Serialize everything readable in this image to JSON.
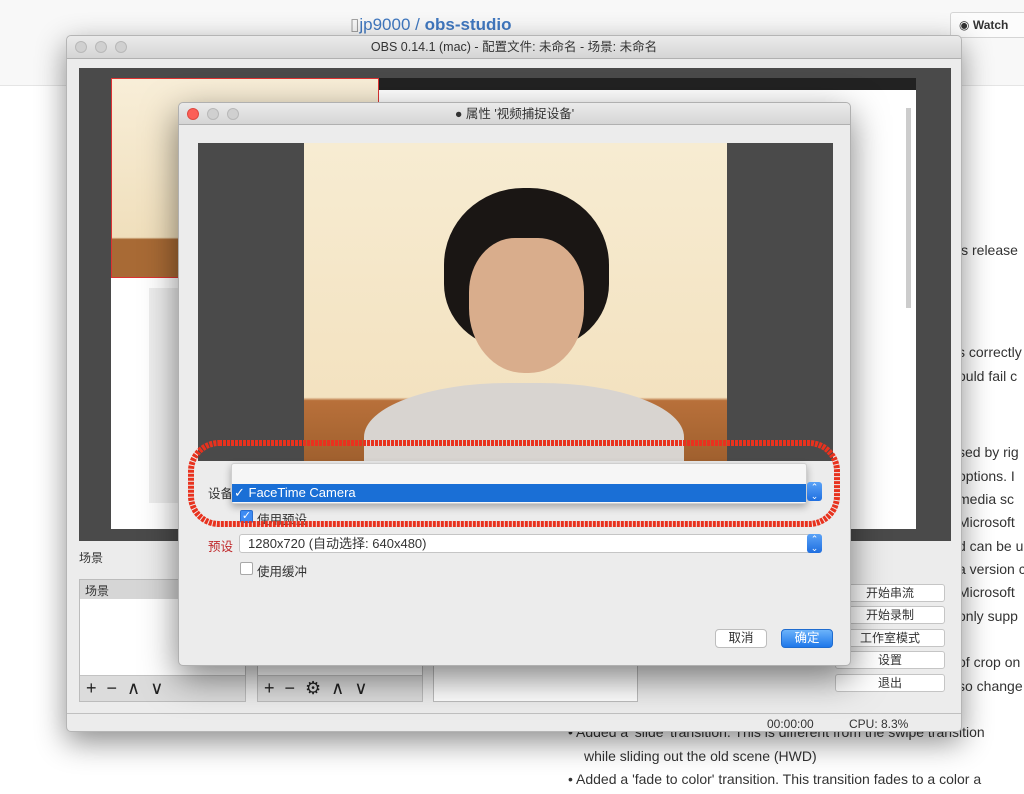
{
  "github": {
    "owner": "jp9000",
    "sep": "/",
    "repo": "obs-studio",
    "watch_label": "Watch",
    "right_fragments": [
      "is release",
      "s correctly",
      "ould fail c",
      "sed by rig",
      "options. I",
      "media sc",
      "Microsoft",
      "d can be u",
      "a version c",
      "Microsoft",
      "only supp",
      "of crop on",
      "so change"
    ],
    "bottom_lines": [
      "• Added a 'slide' transition. This is different from the swipe transition",
      "while sliding out the old scene (HWD)",
      "• Added a 'fade to color' transition. This transition fades to a color a"
    ]
  },
  "obs": {
    "title": "OBS 0.14.1 (mac) - 配置文件: 未命名 - 场景: 未命名",
    "scenes_label": "场景",
    "scenes_header": "场景",
    "buttons": [
      "开始串流",
      "开始录制",
      "工作室模式",
      "设置",
      "退出"
    ],
    "time": "00:00:00",
    "cpu": "CPU: 8.3%",
    "scene_controls": [
      "+",
      "−",
      "∧",
      "∨"
    ],
    "source_controls": [
      "+",
      "−",
      "∧",
      "∨"
    ]
  },
  "dialog": {
    "title": "属性 '视频捕捉设备'",
    "device_label": "设备",
    "device_selected": "✓ FaceTime Camera",
    "use_preset_label": "使用预设",
    "use_preset_checked": true,
    "preset_label": "预设",
    "preset_value": "1280x720 (自动选择: 640x480)",
    "use_buffer_label": "使用缓冲",
    "use_buffer_checked": false,
    "cancel": "取消",
    "ok": "确定"
  },
  "colors": {
    "annotation": "#e8321e",
    "accent": "#1a6fd6",
    "preset_label": "#c0282b"
  }
}
